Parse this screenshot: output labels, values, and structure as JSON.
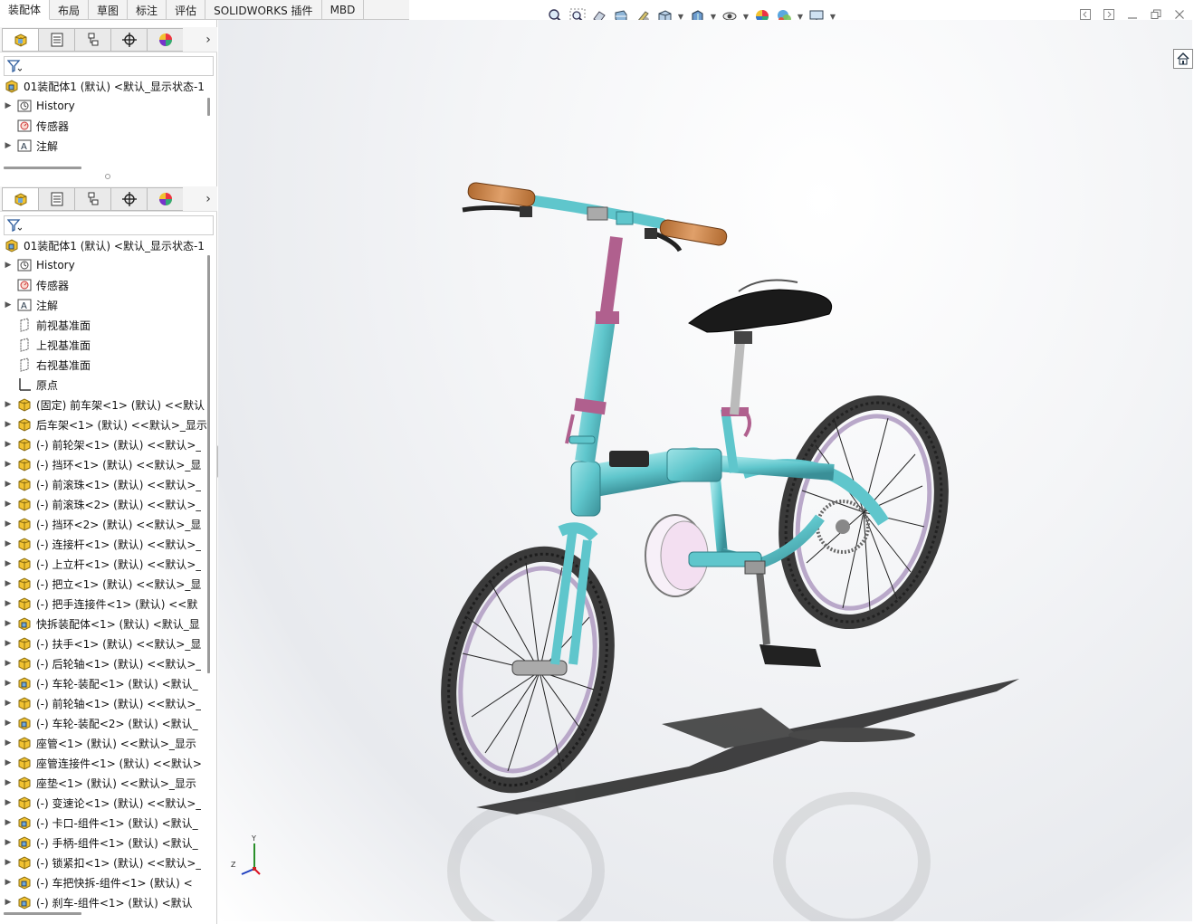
{
  "command_tabs": [
    {
      "label": "装配体",
      "active": true
    },
    {
      "label": "布局",
      "active": false
    },
    {
      "label": "草图",
      "active": false
    },
    {
      "label": "标注",
      "active": false
    },
    {
      "label": "评估",
      "active": false
    },
    {
      "label": "SOLIDWORKS 插件",
      "active": false
    },
    {
      "label": "MBD",
      "active": false
    }
  ],
  "hud_icons": [
    "zoom-to-fit-icon",
    "zoom-area-icon",
    "previous-view-icon",
    "section-view-icon",
    "dynamic-annotation-icon",
    "view-orientation-icon",
    "display-style-icon",
    "hide-show-icon",
    "edit-appearance-icon",
    "apply-scene-icon",
    "view-settings-icon"
  ],
  "top_pane": {
    "root": "01装配体1 (默认) <默认_显示状态-1",
    "items": [
      {
        "label": "History",
        "icon": "history-icon",
        "expandable": true
      },
      {
        "label": "传感器",
        "icon": "sensor-icon",
        "expandable": false
      },
      {
        "label": "注解",
        "icon": "annotation-icon",
        "expandable": true
      }
    ]
  },
  "bottom_pane": {
    "root": "01装配体1 (默认) <默认_显示状态-1",
    "items": [
      {
        "label": "History",
        "icon": "history-icon",
        "expandable": true
      },
      {
        "label": "传感器",
        "icon": "sensor-icon",
        "expandable": false
      },
      {
        "label": "注解",
        "icon": "annotation-icon",
        "expandable": true
      },
      {
        "label": "前视基准面",
        "icon": "plane-icon",
        "expandable": false
      },
      {
        "label": "上视基准面",
        "icon": "plane-icon",
        "expandable": false
      },
      {
        "label": "右视基准面",
        "icon": "plane-icon",
        "expandable": false
      },
      {
        "label": "原点",
        "icon": "origin-icon",
        "expandable": false
      },
      {
        "label": "(固定) 前车架<1> (默认) <<默认",
        "icon": "part-icon",
        "expandable": true
      },
      {
        "label": "后车架<1> (默认) <<默认>_显示",
        "icon": "part-icon",
        "expandable": true
      },
      {
        "label": "(-) 前轮架<1> (默认) <<默认>_",
        "icon": "part-icon",
        "expandable": true
      },
      {
        "label": "(-) 挡环<1> (默认) <<默认>_显",
        "icon": "part-icon",
        "expandable": true
      },
      {
        "label": "(-) 前滚珠<1> (默认) <<默认>_",
        "icon": "part-icon",
        "expandable": true
      },
      {
        "label": "(-) 前滚珠<2> (默认) <<默认>_",
        "icon": "part-icon",
        "expandable": true
      },
      {
        "label": "(-) 挡环<2> (默认) <<默认>_显",
        "icon": "part-icon",
        "expandable": true
      },
      {
        "label": "(-) 连接杆<1> (默认) <<默认>_",
        "icon": "part-icon",
        "expandable": true
      },
      {
        "label": "(-) 上立杆<1> (默认) <<默认>_",
        "icon": "part-icon",
        "expandable": true
      },
      {
        "label": "(-) 把立<1> (默认) <<默认>_显",
        "icon": "part-icon",
        "expandable": true
      },
      {
        "label": "(-) 把手连接件<1> (默认) <<默",
        "icon": "part-icon",
        "expandable": true
      },
      {
        "label": "快拆装配体<1> (默认) <默认_显",
        "icon": "assembly-icon",
        "expandable": true
      },
      {
        "label": "(-) 扶手<1> (默认) <<默认>_显",
        "icon": "part-icon",
        "expandable": true
      },
      {
        "label": "(-) 后轮轴<1> (默认) <<默认>_",
        "icon": "part-icon",
        "expandable": true
      },
      {
        "label": "(-) 车轮-装配<1> (默认) <默认_",
        "icon": "assembly-icon",
        "expandable": true
      },
      {
        "label": "(-) 前轮轴<1> (默认) <<默认>_",
        "icon": "part-icon",
        "expandable": true
      },
      {
        "label": "(-) 车轮-装配<2> (默认) <默认_",
        "icon": "assembly-icon",
        "expandable": true
      },
      {
        "label": "座管<1> (默认) <<默认>_显示",
        "icon": "part-icon",
        "expandable": true
      },
      {
        "label": "座管连接件<1> (默认) <<默认>",
        "icon": "part-icon",
        "expandable": true
      },
      {
        "label": "座垫<1> (默认) <<默认>_显示",
        "icon": "part-icon",
        "expandable": true
      },
      {
        "label": "(-) 变速论<1> (默认) <<默认>_",
        "icon": "part-icon",
        "expandable": true
      },
      {
        "label": "(-) 卡口-组件<1> (默认) <默认_",
        "icon": "assembly-icon",
        "expandable": true
      },
      {
        "label": "(-) 手柄-组件<1> (默认) <默认_",
        "icon": "assembly-icon",
        "expandable": true
      },
      {
        "label": "(-) 锁紧扣<1> (默认) <<默认>_",
        "icon": "part-icon",
        "expandable": true
      },
      {
        "label": "(-) 车把快拆-组件<1> (默认) <",
        "icon": "assembly-icon",
        "expandable": true
      },
      {
        "label": "(-) 刹车-组件<1> (默认) <默认",
        "icon": "assembly-icon",
        "expandable": true
      }
    ]
  },
  "triad": {
    "y": "Y",
    "z": "Z"
  },
  "colors": {
    "frame": "#5fc6cc",
    "stem": "#b0608e",
    "tire": "#3a3a3a",
    "rim": "#b9a8c9",
    "grip": "#c98a52",
    "saddle": "#1a1a1a"
  }
}
